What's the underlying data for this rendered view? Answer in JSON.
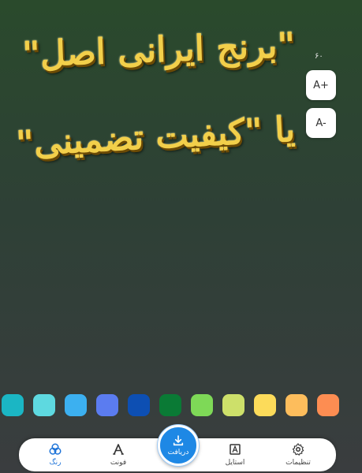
{
  "canvas": {
    "line1": "\"برنج ایرانی اصل\"",
    "line2": "یا \"کیفیت تضمینی\"",
    "text_color": "#f2cf4a"
  },
  "font_size": {
    "value": "۶۰",
    "increase_label": "A+",
    "decrease_label": "A-"
  },
  "palette": [
    "#1bb6c4",
    "#5ed9e0",
    "#3cb0f0",
    "#5b7cf0",
    "#0d4fb3",
    "#0a7a35",
    "#7ed957",
    "#cde06a",
    "#fcdb5a",
    "#fdbd5c",
    "#fd8d52"
  ],
  "bottom_nav": {
    "color_label": "رنگ",
    "font_label": "فونت",
    "download_label": "دریافت",
    "style_label": "استایل",
    "settings_label": "تنظیمات",
    "active_color": "#1f74d8",
    "fab_color": "#1e88e5"
  }
}
